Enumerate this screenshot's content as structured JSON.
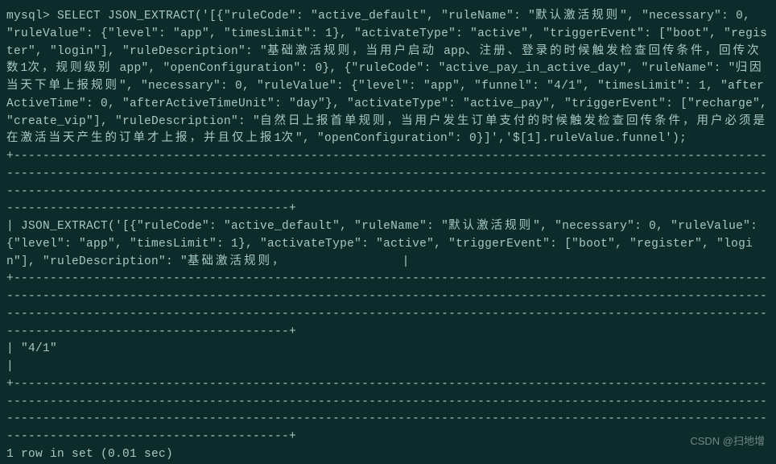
{
  "terminal": {
    "prompt": "mysql> ",
    "query_part1": "SELECT JSON_EXTRACT('[{\"ruleCode\": \"active_default\", \"ruleName\": \"",
    "query_cjk1": "默认激活规则",
    "query_part2": "\", \"necessary\": 0, \"ruleValue\": {\"level\": \"app\", \"timesLimit\": 1}, \"activateType\": \"active\", \"triggerEvent\": [\"boot\", \"register\", \"login\"], \"ruleDescription\": \"",
    "query_cjk2": "基础激活规则，当用户启动",
    "query_part3": " app",
    "query_cjk3": "、注册、登录的时候触发检查回传条件，回传次数",
    "query_part4": "1",
    "query_cjk4": "次，规则级别",
    "query_part5": " app\", \"openConfiguration\": 0}, {\"ruleCode\": \"active_pay_in_active_day\", \"ruleName\": \"",
    "query_cjk5": "归因当天下单上报规则",
    "query_part6": "\", \"necessary\": 0, \"ruleValue\": {\"level\": \"app\", \"funnel\": \"4/1\", \"timesLimit\": 1, \"afterActiveTime\": 0, \"afterActiveTimeUnit\": \"day\"}, \"activateType\": \"active_pay\", \"triggerEvent\": [\"recharge\", \"create_vip\"], \"ruleDescription\": \"",
    "query_cjk6": "自然日上报首单规则，当用户发生订单支付的时候触发检查回传条件，用户必须是在激活当天产生的订单才上报，并且仅上报",
    "query_part7": "1",
    "query_cjk7": "次",
    "query_part8": "\", \"openConfiguration\": 0}]','$[1].ruleValue.funnel');",
    "divider_long": "+-----------------------------------------------------------------------------------------------------------------------------------------------------------------------------------------------------------------------------------------------------------------------------------------------------------------------------------------------------------------+",
    "header_part1": "| JSON_EXTRACT('[{\"ruleCode\": \"active_default\", \"ruleName\": \"",
    "header_cjk1": "默认激活规则",
    "header_part2": "\", \"necessary\": 0, \"ruleValue\": {\"level\": \"app\", \"timesLimit\": 1}, \"activateType\": \"active\", \"triggerEvent\": [\"boot\", \"register\", \"login\"], \"ruleDescription\": \"",
    "header_cjk2": "基础激活规则，",
    "header_part3": "                |",
    "result_row": "| \"4/1\"                                                                                                                                                                                                                                                                                                                                                       |",
    "footer": "1 row in set (0.01 sec)"
  },
  "watermark": "CSDN @扫地增"
}
